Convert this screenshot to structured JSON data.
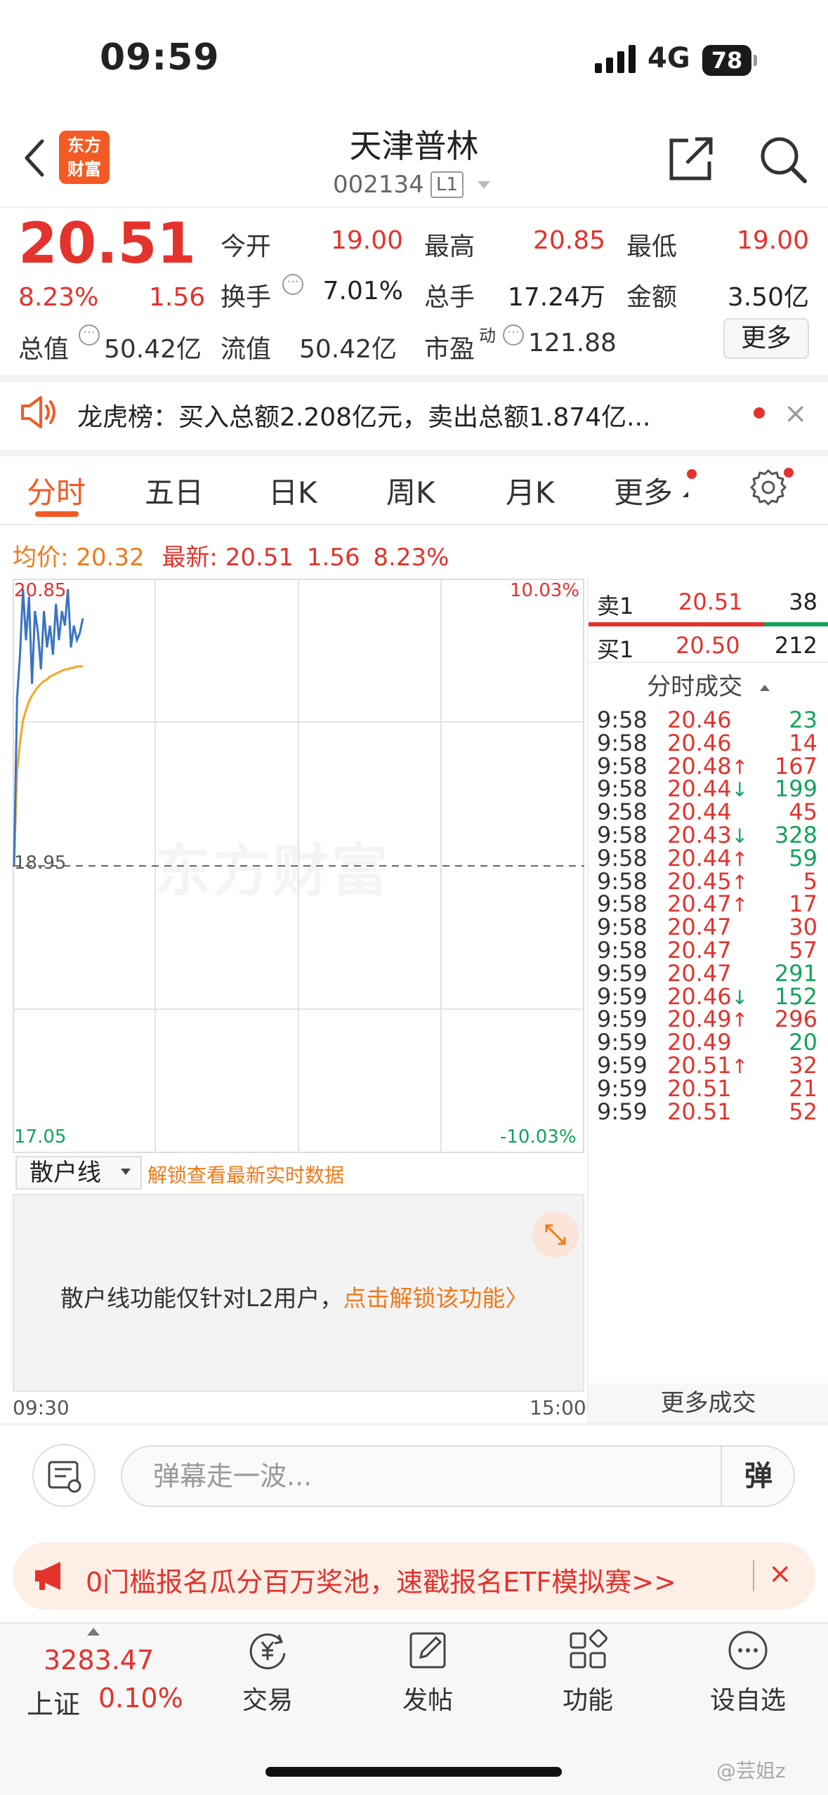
{
  "status": {
    "time": "09:59",
    "network": "4G",
    "battery": "78"
  },
  "header": {
    "logo_line1": "东方",
    "logo_line2": "财富",
    "name": "天津普林",
    "code": "002134",
    "level": "L1"
  },
  "quote": {
    "price": "20.51",
    "pct": "8.23%",
    "change": "1.56",
    "open_label": "今开",
    "open": "19.00",
    "high_label": "最高",
    "high": "20.85",
    "low_label": "最低",
    "low": "19.00",
    "turnover_label": "换手",
    "turnover": "7.01%",
    "volume_label": "总手",
    "volume": "17.24万",
    "amount_label": "金额",
    "amount": "3.50亿",
    "mcap_label": "总值",
    "mcap": "50.42亿",
    "float_label": "流值",
    "float": "50.42亿",
    "pe_label": "市盈",
    "pe_sup": "动",
    "pe": "121.88",
    "info_glyph": "···",
    "more": "更多"
  },
  "announcement": {
    "text": "龙虎榜：买入总额2.208亿元，卖出总额1.874亿...",
    "close": "×"
  },
  "tabs": [
    "分时",
    "五日",
    "日K",
    "周K",
    "月K",
    "更多"
  ],
  "avg": {
    "avg_label": "均价:",
    "avg": "20.32",
    "latest_label": "最新:",
    "latest": "20.51",
    "change": "1.56",
    "pct": "8.23%"
  },
  "chart_data": {
    "type": "line",
    "y_top_label": "20.85",
    "y_mid_label": "18.95",
    "y_bottom_label": "17.05",
    "pct_top_label": "10.03%",
    "pct_bottom_label": "-10.03%",
    "ylim": [
      17.05,
      20.85
    ],
    "x_start": "09:30",
    "x_end": "15:00",
    "prev_close": 18.95,
    "series": [
      {
        "values": [
          18.95,
          20.1,
          20.4,
          20.85,
          20.5,
          20.8,
          20.2,
          20.7,
          20.55,
          20.3,
          20.7,
          20.45,
          20.6,
          20.4,
          20.75,
          20.5,
          20.7,
          20.6,
          20.85,
          20.45,
          20.6,
          20.5,
          20.55,
          20.65
        ],
        "color": "#3b73c4"
      },
      {
        "values": [
          18.95,
          19.6,
          19.8,
          19.95,
          20.02,
          20.08,
          20.12,
          20.15,
          20.18,
          20.2,
          20.22,
          20.23,
          20.25,
          20.26,
          20.27,
          20.28,
          20.29,
          20.3,
          20.3,
          20.31,
          20.31,
          20.32,
          20.32,
          20.32
        ],
        "color": "#f5a623"
      }
    ],
    "watermark": "东方财富"
  },
  "book": {
    "ask_label": "卖1",
    "ask_price": "20.51",
    "ask_vol": "38",
    "bid_label": "买1",
    "bid_price": "20.50",
    "bid_vol": "212"
  },
  "trades_title": "分时成交",
  "trades": [
    {
      "t": "9:58",
      "p": "20.46",
      "d": "",
      "v": "23",
      "vc": "green"
    },
    {
      "t": "9:58",
      "p": "20.46",
      "d": "",
      "v": "14",
      "vc": "red"
    },
    {
      "t": "9:58",
      "p": "20.48",
      "d": "↑",
      "v": "167",
      "vc": "red"
    },
    {
      "t": "9:58",
      "p": "20.44",
      "d": "↓",
      "v": "199",
      "vc": "green"
    },
    {
      "t": "9:58",
      "p": "20.44",
      "d": "",
      "v": "45",
      "vc": "red"
    },
    {
      "t": "9:58",
      "p": "20.43",
      "d": "↓",
      "v": "328",
      "vc": "green"
    },
    {
      "t": "9:58",
      "p": "20.44",
      "d": "↑",
      "v": "59",
      "vc": "green"
    },
    {
      "t": "9:58",
      "p": "20.45",
      "d": "↑",
      "v": "5",
      "vc": "red"
    },
    {
      "t": "9:58",
      "p": "20.47",
      "d": "↑",
      "v": "17",
      "vc": "red"
    },
    {
      "t": "9:58",
      "p": "20.47",
      "d": "",
      "v": "30",
      "vc": "red"
    },
    {
      "t": "9:58",
      "p": "20.47",
      "d": "",
      "v": "57",
      "vc": "red"
    },
    {
      "t": "9:59",
      "p": "20.47",
      "d": "",
      "v": "291",
      "vc": "green"
    },
    {
      "t": "9:59",
      "p": "20.46",
      "d": "↓",
      "v": "152",
      "vc": "green"
    },
    {
      "t": "9:59",
      "p": "20.49",
      "d": "↑",
      "v": "296",
      "vc": "red"
    },
    {
      "t": "9:59",
      "p": "20.49",
      "d": "",
      "v": "20",
      "vc": "green"
    },
    {
      "t": "9:59",
      "p": "20.51",
      "d": "↑",
      "v": "32",
      "vc": "red"
    },
    {
      "t": "9:59",
      "p": "20.51",
      "d": "",
      "v": "21",
      "vc": "red"
    },
    {
      "t": "9:59",
      "p": "20.51",
      "d": "",
      "v": "52",
      "vc": "red"
    }
  ],
  "more_trades": "更多成交",
  "sub": {
    "select": "散户线",
    "unlock": "解锁查看最新实时数据",
    "msg_a": "散户线功能仅针对L2用户，",
    "msg_b": "点击解锁该功能〉"
  },
  "danmu": {
    "placeholder": "弹幕走一波...",
    "send": "弹"
  },
  "promo": {
    "text": "0门槛报名瓜分百万奖池，速戳报名ETF模拟赛>>",
    "close": "×"
  },
  "bottom": {
    "index_value": "3283.47",
    "index_name": "上证",
    "index_pct": "0.10%",
    "nav": [
      "交易",
      "发帖",
      "功能",
      "设自选"
    ]
  },
  "watermark": "@芸姐z",
  "colors": {
    "up": "#e4322c",
    "down": "#12a35a",
    "accent": "#f45a23"
  }
}
